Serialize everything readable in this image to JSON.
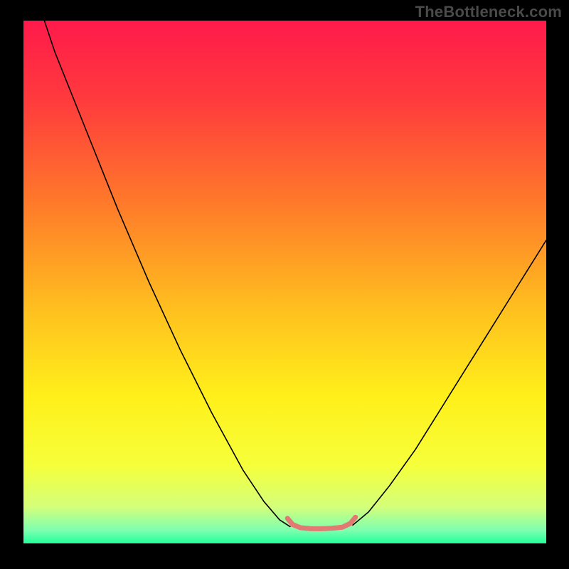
{
  "watermark": "TheBottleneck.com",
  "chart_data": {
    "type": "line",
    "title": "",
    "xlabel": "",
    "ylabel": "",
    "xlim": [
      0,
      100
    ],
    "ylim": [
      0,
      100
    ],
    "grid": false,
    "legend": false,
    "annotations": [],
    "gradient_stops": [
      {
        "offset": 0.0,
        "color": "#ff1a4b"
      },
      {
        "offset": 0.15,
        "color": "#ff3a3d"
      },
      {
        "offset": 0.35,
        "color": "#ff7a2a"
      },
      {
        "offset": 0.55,
        "color": "#ffbf1f"
      },
      {
        "offset": 0.72,
        "color": "#fff01a"
      },
      {
        "offset": 0.85,
        "color": "#f6ff3a"
      },
      {
        "offset": 0.93,
        "color": "#d4ff7a"
      },
      {
        "offset": 0.975,
        "color": "#7dffb0"
      },
      {
        "offset": 1.0,
        "color": "#23ff9a"
      }
    ],
    "series": [
      {
        "name": "curve-left",
        "color": "#000000",
        "width": 1.6,
        "points": [
          {
            "x": 4,
            "y": 100
          },
          {
            "x": 6,
            "y": 94
          },
          {
            "x": 10,
            "y": 84
          },
          {
            "x": 14,
            "y": 74
          },
          {
            "x": 18,
            "y": 64
          },
          {
            "x": 24,
            "y": 50
          },
          {
            "x": 30,
            "y": 37
          },
          {
            "x": 36,
            "y": 25
          },
          {
            "x": 42,
            "y": 14
          },
          {
            "x": 46,
            "y": 8
          },
          {
            "x": 49,
            "y": 4.5
          },
          {
            "x": 51,
            "y": 3.2
          }
        ]
      },
      {
        "name": "curve-right",
        "color": "#000000",
        "width": 1.6,
        "points": [
          {
            "x": 63,
            "y": 3.5
          },
          {
            "x": 66,
            "y": 6
          },
          {
            "x": 70,
            "y": 11
          },
          {
            "x": 75,
            "y": 18
          },
          {
            "x": 80,
            "y": 26
          },
          {
            "x": 85,
            "y": 34
          },
          {
            "x": 90,
            "y": 42
          },
          {
            "x": 95,
            "y": 50
          },
          {
            "x": 100,
            "y": 58
          }
        ]
      },
      {
        "name": "bottom-band",
        "color": "#e27a73",
        "width": 7,
        "points": [
          {
            "x": 50.5,
            "y": 4.8
          },
          {
            "x": 51.5,
            "y": 3.6
          },
          {
            "x": 53,
            "y": 3.0
          },
          {
            "x": 55,
            "y": 2.8
          },
          {
            "x": 57,
            "y": 2.8
          },
          {
            "x": 59,
            "y": 2.9
          },
          {
            "x": 61,
            "y": 3.1
          },
          {
            "x": 62.5,
            "y": 3.8
          },
          {
            "x": 63.5,
            "y": 5.0
          }
        ]
      }
    ]
  }
}
